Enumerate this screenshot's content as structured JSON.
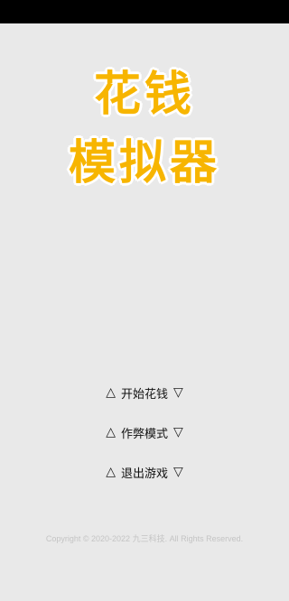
{
  "title": {
    "line1": "花钱",
    "line2": "模拟器"
  },
  "menu": {
    "items": [
      {
        "label": "开始花钱"
      },
      {
        "label": "作弊模式"
      },
      {
        "label": "退出游戏"
      }
    ],
    "left_glyph": "△",
    "right_glyph": "▽"
  },
  "footer": {
    "copyright": "Copyright © 2020-2022 九三科技. All Rights Reserved."
  },
  "colors": {
    "background": "#e9e9e9",
    "title": "#f7b500",
    "status_bar": "#000000"
  }
}
